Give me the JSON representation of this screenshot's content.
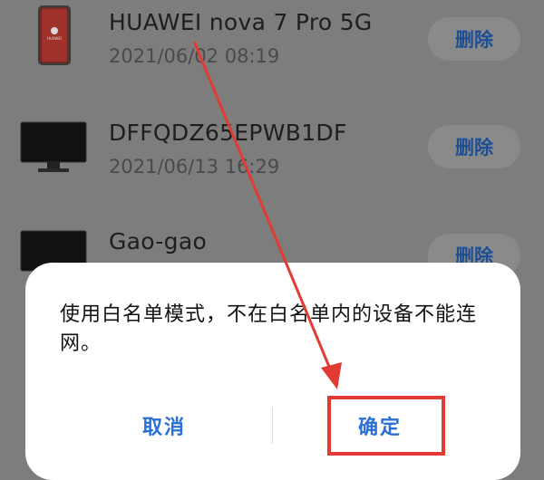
{
  "devices": [
    {
      "name": "HUAWEI nova 7 Pro 5G",
      "time": "2021/06/02 08:19",
      "delete_label": "删除",
      "icon": "phone-icon",
      "brand_text": "HUAWEI"
    },
    {
      "name": "DFFQDZ65EPWB1DF",
      "time": "2021/06/13 16:29",
      "delete_label": "删除",
      "icon": "monitor-icon"
    },
    {
      "name": "Gao-gao",
      "time": "",
      "delete_label": "删除",
      "icon": "monitor-icon"
    }
  ],
  "dialog": {
    "message": "使用白名单模式，不在白名单内的设备不能连网。",
    "cancel_label": "取消",
    "confirm_label": "确定"
  },
  "colors": {
    "annotation": "#e23b34",
    "dialog_button": "#2b6fd6",
    "delete_text": "#1c4e96",
    "overlay_background": "#7d7d7d"
  }
}
